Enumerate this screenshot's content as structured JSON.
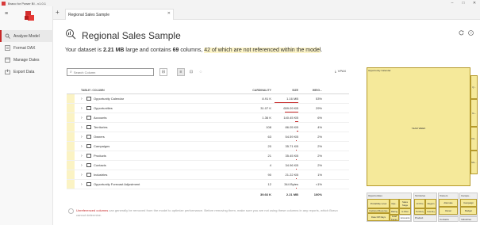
{
  "window": {
    "title": "Bravo for Power BI - v1.0.1"
  },
  "sidebar": {
    "items": [
      {
        "label": "Analyze Model",
        "icon": "analyze-icon",
        "active": true
      },
      {
        "label": "Format DAX",
        "icon": "format-icon"
      },
      {
        "label": "Manage Dates",
        "icon": "calendar-icon"
      },
      {
        "label": "Export Data",
        "icon": "export-icon"
      }
    ]
  },
  "tabs": [
    {
      "label": "Regional Sales Sample"
    }
  ],
  "main": {
    "title": "Regional Sales Sample",
    "summary": {
      "prefix": "Your dataset is ",
      "size": "2.21 MB",
      "mid": " large and contains ",
      "columns": "69",
      "mid2": " columns, ",
      "unref": "42 of which are not referenced within the model",
      "suffix": "."
    },
    "search_placeholder": "Search Column",
    "vpax_label": "VPAX"
  },
  "table": {
    "headers": {
      "name": "TABLE \\ COLUMN",
      "cardinality": "CARDINALITY",
      "size": "SIZE",
      "weight": "WEIG..."
    },
    "rows": [
      {
        "name": "Opportunity Calendar",
        "cardinality": "8.91 K",
        "size": "1.16 MB",
        "weight": "53%",
        "frac": 1.0
      },
      {
        "name": "Opportunities",
        "cardinality": "31.07 K",
        "size": "659.09 KB",
        "weight": "29%",
        "frac": 0.57
      },
      {
        "name": "Accounts",
        "cardinality": "1.36 K",
        "size": "140.45 KB",
        "weight": "6%",
        "frac": 0.12
      },
      {
        "name": "Territories",
        "cardinality": "108",
        "size": "86.05 KB",
        "weight": "4%",
        "frac": 0.07
      },
      {
        "name": "Owners",
        "cardinality": "63",
        "size": "54.59 KB",
        "weight": "2%",
        "frac": 0.05
      },
      {
        "name": "Campaigns",
        "cardinality": "20",
        "size": "35.71 KB",
        "weight": "2%",
        "frac": 0.03
      },
      {
        "name": "Products",
        "cardinality": "21",
        "size": "35.45 KB",
        "weight": "2%",
        "frac": 0.03
      },
      {
        "name": "Contacts",
        "cardinality": "4",
        "size": "34.96 KB",
        "weight": "2%",
        "frac": 0.03
      },
      {
        "name": "Industries",
        "cardinality": "90",
        "size": "21.22 KB",
        "weight": "1%",
        "frac": 0.02
      },
      {
        "name": "Opportunity Forecast Adjustment",
        "cardinality": "12",
        "size": "344 Bytes",
        "weight": "<1%",
        "frac": 0.0
      }
    ],
    "totals": {
      "cardinality": "39.66 K",
      "size": "2.21 MB",
      "weight": "100%"
    }
  },
  "hint": {
    "link": "Unreferenced columns",
    "text": " can generally be removed from the model to optimize performance. Before removing them, make sure you are not using these columns in any reports, which Bravo cannot determine."
  },
  "treemap": {
    "opportunity_calendar": {
      "label": "Opportunity Calendar",
      "center": "YEAR WEEK",
      "side": [
        "Q...",
        "Ye...",
        "Fis...",
        "Mo..."
      ]
    },
    "opportunities": {
      "label": "Opportunities",
      "cells": [
        "Probability Level",
        "Ope...",
        "Sales Stage",
        "Rating",
        "Is Won",
        "Factored Revenue",
        "Date Diff Days",
        "Lead Factor",
        "Accounts"
      ]
    },
    "territories": {
      "label": "Territories",
      "cells": [
        "Or Prio",
        "Region",
        "Territory",
        "Country"
      ]
    },
    "owners": {
      "label": "Owners",
      "cells": [
        "Alternate",
        "Owner"
      ]
    },
    "campaigns": {
      "label": "Campa...",
      "cells": [
        "Campaign",
        "Budget"
      ]
    },
    "products": {
      "label": "Product",
      "cells": [
        "Product Line"
      ]
    },
    "contacts": {
      "label": "Contacts",
      "cells": [
        "Product",
        "List Price",
        "Contact"
      ]
    },
    "industries": {
      "label": "Industries"
    }
  },
  "colors": {
    "accent": "#c62828",
    "highlight": "#fdf5c9",
    "treemap_fill": "#f5e99a"
  }
}
